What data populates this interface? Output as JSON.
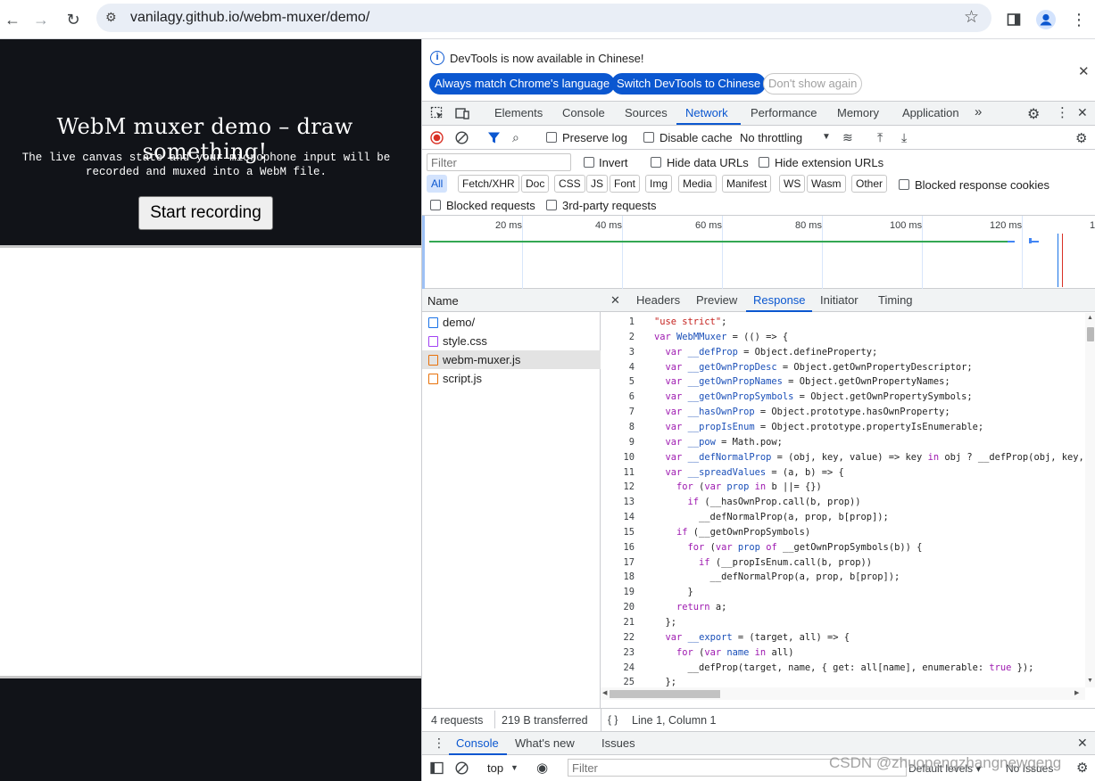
{
  "browser": {
    "url": "vanilagy.github.io/webm-muxer/demo/"
  },
  "page": {
    "title": "WebM muxer demo – draw something!",
    "description": "The live canvas state and your microphone input will be recorded and muxed into a WebM file.",
    "button_label": "Start recording"
  },
  "devtools": {
    "infobar": {
      "message": "DevTools is now available in Chinese!",
      "btn_match": "Always match Chrome's language",
      "btn_switch": "Switch DevTools to Chinese",
      "btn_dismiss": "Don't show again"
    },
    "tabs": [
      "Elements",
      "Console",
      "Sources",
      "Network",
      "Performance",
      "Memory",
      "Application"
    ],
    "tabs_more": "»",
    "network_toolbar": {
      "preserve_log": "Preserve log",
      "disable_cache": "Disable cache",
      "throttling": "No throttling"
    },
    "filter": {
      "placeholder": "Filter",
      "invert": "Invert",
      "hide_data_urls": "Hide data URLs",
      "hide_extension_urls": "Hide extension URLs",
      "types": [
        "All",
        "Fetch/XHR",
        "Doc",
        "CSS",
        "JS",
        "Font",
        "Img",
        "Media",
        "Manifest",
        "WS",
        "Wasm",
        "Other"
      ],
      "blocked_response_cookies": "Blocked response cookies",
      "blocked_requests": "Blocked requests",
      "third_party": "3rd-party requests"
    },
    "overview_ticks": [
      "20 ms",
      "40 ms",
      "60 ms",
      "80 ms",
      "100 ms",
      "120 ms",
      "1"
    ],
    "requests": {
      "header": "Name",
      "items": [
        {
          "name": "demo/",
          "type": "doc",
          "color": "#1a73e8"
        },
        {
          "name": "style.css",
          "type": "css",
          "color": "#a142f4"
        },
        {
          "name": "webm-muxer.js",
          "type": "js",
          "color": "#e8710a"
        },
        {
          "name": "script.js",
          "type": "js",
          "color": "#e8710a"
        }
      ]
    },
    "detail_tabs": [
      "Headers",
      "Preview",
      "Response",
      "Initiator",
      "Timing"
    ],
    "code_lines": [
      {
        "n": "1",
        "t": "\"use strict\";"
      },
      {
        "n": "2",
        "t": "var WebMMuxer = (() => {"
      },
      {
        "n": "3",
        "t": "  var __defProp = Object.defineProperty;"
      },
      {
        "n": "4",
        "t": "  var __getOwnPropDesc = Object.getOwnPropertyDescriptor;"
      },
      {
        "n": "5",
        "t": "  var __getOwnPropNames = Object.getOwnPropertyNames;"
      },
      {
        "n": "6",
        "t": "  var __getOwnPropSymbols = Object.getOwnPropertySymbols;"
      },
      {
        "n": "7",
        "t": "  var __hasOwnProp = Object.prototype.hasOwnProperty;"
      },
      {
        "n": "8",
        "t": "  var __propIsEnum = Object.prototype.propertyIsEnumerable;"
      },
      {
        "n": "9",
        "t": "  var __pow = Math.pow;"
      },
      {
        "n": "10",
        "t": "  var __defNormalProp = (obj, key, value) => key in obj ? __defProp(obj, key, {"
      },
      {
        "n": "11",
        "t": "  var __spreadValues = (a, b) => {"
      },
      {
        "n": "12",
        "t": "    for (var prop in b ||= {})"
      },
      {
        "n": "13",
        "t": "      if (__hasOwnProp.call(b, prop))"
      },
      {
        "n": "14",
        "t": "        __defNormalProp(a, prop, b[prop]);"
      },
      {
        "n": "15",
        "t": "    if (__getOwnPropSymbols)"
      },
      {
        "n": "16",
        "t": "      for (var prop of __getOwnPropSymbols(b)) {"
      },
      {
        "n": "17",
        "t": "        if (__propIsEnum.call(b, prop))"
      },
      {
        "n": "18",
        "t": "          __defNormalProp(a, prop, b[prop]);"
      },
      {
        "n": "19",
        "t": "      }"
      },
      {
        "n": "20",
        "t": "    return a;"
      },
      {
        "n": "21",
        "t": "  };"
      },
      {
        "n": "22",
        "t": "  var __export = (target, all) => {"
      },
      {
        "n": "23",
        "t": "    for (var name in all)"
      },
      {
        "n": "24",
        "t": "      __defProp(target, name, { get: all[name], enumerable: true });"
      },
      {
        "n": "25",
        "t": "  };"
      }
    ],
    "status": {
      "requests": "4 requests",
      "transferred": "219 B transferred",
      "position": "Line 1, Column 1"
    },
    "drawer": {
      "tabs": [
        "Console",
        "What's new",
        "Issues"
      ],
      "context": "top",
      "filter_placeholder": "Filter",
      "levels": "Default levels ▾",
      "issues": "No Issues"
    }
  },
  "watermark": "CSDN @zhuopengzhangnewgeng",
  "colors": {
    "accent": "#0b57d0",
    "page_dark": "#111318"
  }
}
